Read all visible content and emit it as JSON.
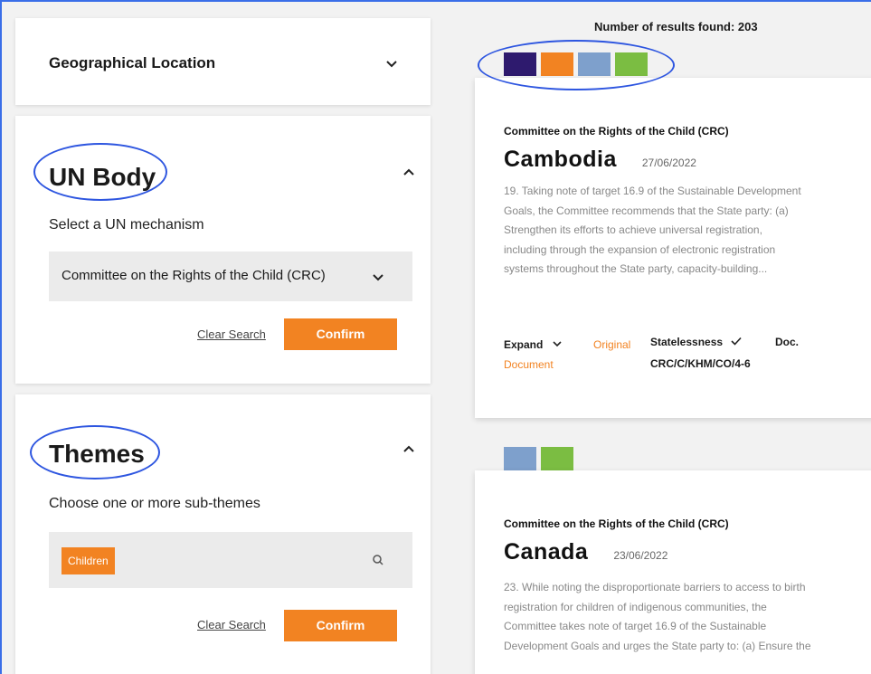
{
  "filters": {
    "geo": {
      "title": "Geographical Location"
    },
    "un_body": {
      "title": "UN Body",
      "label": "Select a UN mechanism",
      "selected": "Committee on the Rights of the Child (CRC)",
      "clear_label": "Clear Search",
      "confirm_label": "Confirm"
    },
    "themes": {
      "title": "Themes",
      "label": "Choose one or more sub-themes",
      "tags": [
        "Children"
      ],
      "clear_label": "Clear Search",
      "confirm_label": "Confirm"
    }
  },
  "results": {
    "count_text": "Number of results found: 203",
    "legend_colors": [
      "#2e1a6e",
      "#f28322",
      "#7ea0cc",
      "#7bbd42"
    ],
    "cards": [
      {
        "committee": "Committee on the Rights of the Child (CRC)",
        "country": "Cambodia",
        "date": "27/06/2022",
        "lines": [
          "19. Taking note of target 16.9 of the Sustainable Development",
          "Goals, the Committee recommends that the State party: (a)",
          "Strengthen its efforts to achieve universal registration,",
          "including through the expansion of electronic registration",
          "systems throughout the State party, capacity-building..."
        ],
        "expand_label": "Expand",
        "original_label_1": "Original",
        "original_label_2": "Document",
        "theme_label": "Statelessness",
        "doc_label": "Doc.",
        "doc_code": "CRC/C/KHM/CO/4-6"
      },
      {
        "swatch_colors": [
          "#7ea0cc",
          "#7bbd42"
        ],
        "committee": "Committee on the Rights of the Child (CRC)",
        "country": "Canada",
        "date": "23/06/2022",
        "lines": [
          "23. While noting the disproportionate barriers to access to birth",
          "registration for children of indigenous communities, the",
          "Committee takes note of target 16.9 of the Sustainable",
          "Development Goals and urges the State party to: (a) Ensure the"
        ]
      }
    ]
  }
}
